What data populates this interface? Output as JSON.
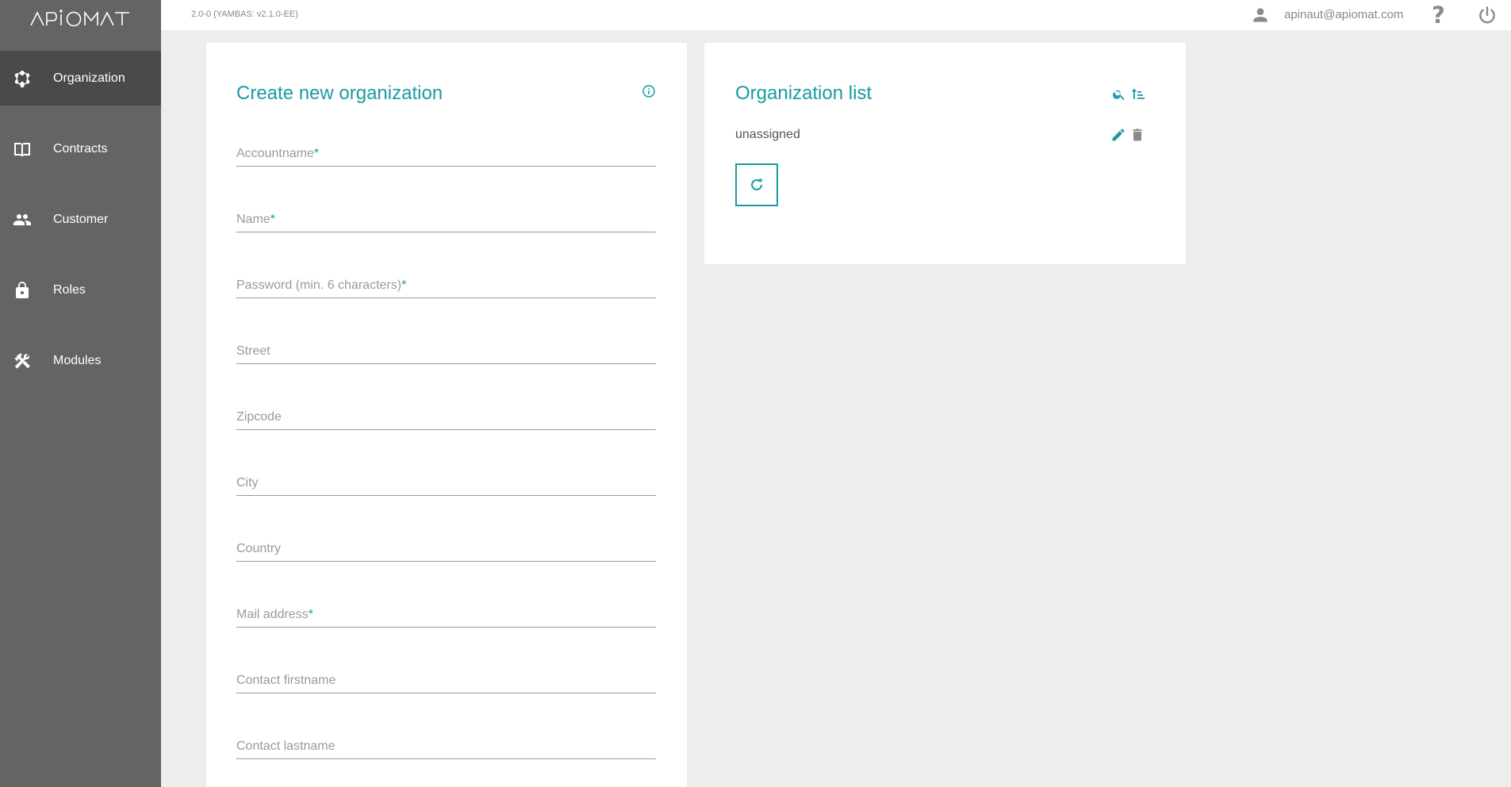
{
  "app": {
    "logo_text": "APIOMAT",
    "version": "2.0-0 (YAMBAS: v2.1.0-EE)",
    "user_email": "apinaut@apiomat.com",
    "accent_color": "#1a9ba1"
  },
  "sidebar": {
    "items": [
      {
        "label": "Organization",
        "icon": "organization-icon",
        "active": true
      },
      {
        "label": "Contracts",
        "icon": "book-icon",
        "active": false
      },
      {
        "label": "Customer",
        "icon": "people-icon",
        "active": false
      },
      {
        "label": "Roles",
        "icon": "lock-icon",
        "active": false
      },
      {
        "label": "Modules",
        "icon": "tools-icon",
        "active": false
      }
    ]
  },
  "create_panel": {
    "title": "Create new organization",
    "fields": [
      {
        "label": "Accountname",
        "required": "*"
      },
      {
        "label": "Name",
        "required": "*"
      },
      {
        "label": "Password (min. 6 characters)",
        "required": "*"
      },
      {
        "label": "Street",
        "required": ""
      },
      {
        "label": "Zipcode",
        "required": ""
      },
      {
        "label": "City",
        "required": ""
      },
      {
        "label": "Country",
        "required": ""
      },
      {
        "label": "Mail address",
        "required": "*"
      },
      {
        "label": "Contact firstname",
        "required": ""
      },
      {
        "label": "Contact lastname",
        "required": ""
      }
    ]
  },
  "list_panel": {
    "title": "Organization list",
    "items": [
      {
        "label": "unassigned"
      }
    ]
  }
}
